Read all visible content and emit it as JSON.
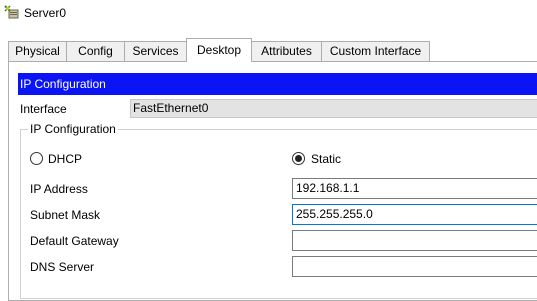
{
  "window": {
    "title": "Server0",
    "icon": "server-device-icon"
  },
  "tabs": [
    {
      "label": "Physical",
      "active": false
    },
    {
      "label": "Config",
      "active": false
    },
    {
      "label": "Services",
      "active": false
    },
    {
      "label": "Desktop",
      "active": true
    },
    {
      "label": "Attributes",
      "active": false
    },
    {
      "label": "Custom Interface",
      "active": false
    }
  ],
  "panel": {
    "header": "IP Configuration",
    "header_color": "#0a14f5",
    "interface_label": "Interface",
    "interface_value": "FastEthernet0"
  },
  "ip_config": {
    "group_title": "IP Configuration",
    "dhcp_label": "DHCP",
    "static_label": "Static",
    "mode": "Static",
    "fields": [
      {
        "label": "IP Address",
        "value": "192.168.1.1"
      },
      {
        "label": "Subnet Mask",
        "value": "255.255.255.0"
      },
      {
        "label": "Default Gateway",
        "value": ""
      },
      {
        "label": "DNS Server",
        "value": ""
      }
    ]
  }
}
